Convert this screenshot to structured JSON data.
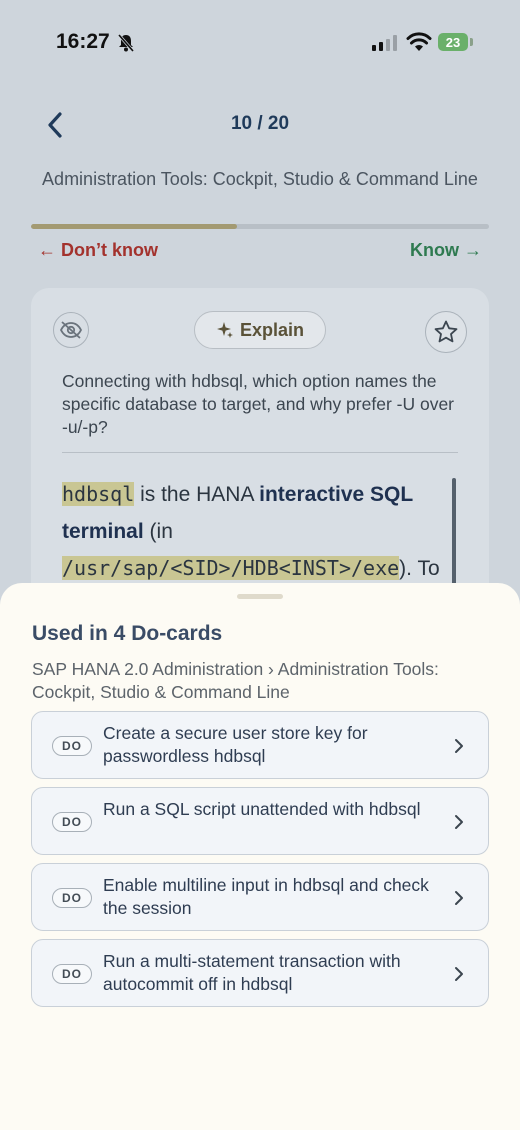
{
  "status_bar": {
    "time": "16:27",
    "battery": "23"
  },
  "header": {
    "progress": "10 / 20",
    "progress_fraction": 0.45,
    "deck_title": "Administration Tools: Cockpit, Studio & Command Line",
    "dont_know_label": "← Don’t know",
    "know_label": "Know →"
  },
  "card": {
    "explain_label": "Explain",
    "question": "Connecting with hdbsql, which option names the specific database to target, and why prefer -U over -u/-p?",
    "answer": {
      "cmd": "hdbsql",
      "t1": " is the HANA ",
      "b1": "interactive SQL terminal",
      "t2": " (in ",
      "path": "/usr/sap/<SID>/HDB<INST>/exe",
      "t3": "). To name a"
    }
  },
  "sheet": {
    "title": "Used in 4 Do-cards",
    "breadcrumb": "SAP HANA 2.0 Administration › Administration Tools: Cockpit, Studio & Command Line",
    "badge": "DO",
    "items": [
      {
        "label": "Create a secure user store key for passwordless hdbsql"
      },
      {
        "label": "Run a SQL script unattended with hdbsql"
      },
      {
        "label": "Enable multiline input in hdbsql and check the session"
      },
      {
        "label": "Run a multi-statement transaction with autocommit off in hdbsql"
      }
    ]
  },
  "colors": {
    "dont_know": "#a3322d",
    "know": "#2e7a50",
    "highlight": "#c9c693",
    "progress_fill": "#a39a72"
  },
  "icons": {
    "back": "chevron-left-icon",
    "hide": "eye-slash-icon",
    "explain": "sparkle-icon",
    "star": "star-icon",
    "chevron": "chevron-right-icon"
  }
}
